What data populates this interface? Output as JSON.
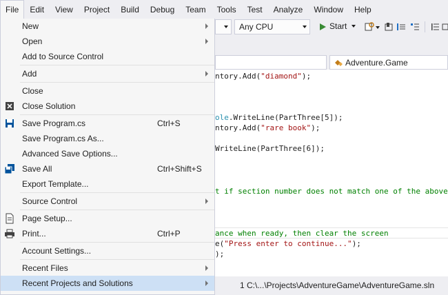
{
  "menubar": {
    "items": [
      "File",
      "Edit",
      "View",
      "Project",
      "Build",
      "Debug",
      "Team",
      "Tools",
      "Test",
      "Analyze",
      "Window",
      "Help"
    ],
    "active": "File"
  },
  "toolbar": {
    "platform": "Any CPU",
    "start_label": "Start",
    "colors": {
      "play": "#388a34"
    }
  },
  "navbar": {
    "right": "Adventure.Game",
    "right_icon": "class-icon"
  },
  "code": {
    "lines": [
      {
        "text": "ntory.Add(\"diamond\");"
      },
      {
        "text": "ole.WriteLine(PartThree[5]);"
      },
      {
        "text": "ntory.Add(\"rare book\");"
      },
      {
        "text": "WriteLine(PartThree[6]);"
      },
      {
        "text": "t if section number does not match one of the above"
      },
      {
        "text": "ance when ready, then clear the screen"
      },
      {
        "text": "e(\"Press enter to continue...\");"
      },
      {
        "text": ");"
      }
    ]
  },
  "recent_path": "1 C:\\...\\Projects\\AdventureGame\\AdventureGame.sln",
  "file_menu": {
    "items": [
      {
        "label": "New",
        "submenu": true
      },
      {
        "label": "Open",
        "submenu": true
      },
      {
        "label": "Add to Source Control"
      },
      {
        "label": "Add",
        "submenu": true
      },
      {
        "label": "Close"
      },
      {
        "label": "Close Solution",
        "icon": "close-solution-icon"
      },
      {
        "label": "Save Program.cs",
        "shortcut": "Ctrl+S",
        "icon": "save-icon"
      },
      {
        "label": "Save Program.cs As..."
      },
      {
        "label": "Advanced Save Options..."
      },
      {
        "label": "Save All",
        "shortcut": "Ctrl+Shift+S",
        "icon": "save-all-icon"
      },
      {
        "label": "Export Template..."
      },
      {
        "label": "Source Control",
        "submenu": true
      },
      {
        "label": "Page Setup...",
        "icon": "page-setup-icon"
      },
      {
        "label": "Print...",
        "shortcut": "Ctrl+P",
        "icon": "print-icon"
      },
      {
        "label": "Account Settings..."
      },
      {
        "label": "Recent Files",
        "submenu": true
      },
      {
        "label": "Recent Projects and Solutions",
        "submenu": true,
        "highlighted": true
      }
    ]
  },
  "colors": {
    "menu_bg": "#f6f6f6",
    "highlight": "#cde0f5",
    "string": "#a31515",
    "comment": "#008000",
    "type": "#2b91af"
  }
}
